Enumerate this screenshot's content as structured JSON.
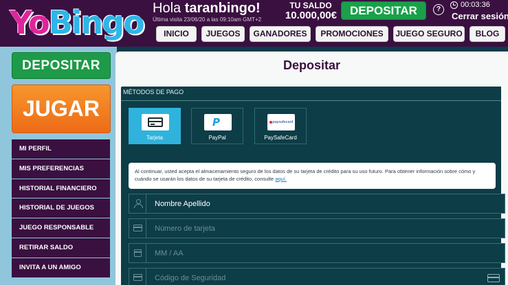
{
  "header": {
    "logo_text": "YoBingo",
    "greeting_prefix": "Hola",
    "username": "taranbingo!",
    "last_visit": "Última visita 23/06/20 a las 09:10am GMT+2",
    "saldo_label": "TU SALDO",
    "saldo_value": "10.000,00€",
    "deposit_label": "DEPOSITAR",
    "help_symbol": "?",
    "timer": "00:03:36",
    "logout_label": "Cerrar sesión"
  },
  "nav": {
    "items": [
      {
        "label": "INICIO"
      },
      {
        "label": "JUEGOS"
      },
      {
        "label": "GANADORES"
      },
      {
        "label": "PROMOCIONES"
      },
      {
        "label": "JUEGO SEGURO"
      },
      {
        "label": "BLOG"
      }
    ]
  },
  "sidebar": {
    "deposit_label": "DEPOSITAR",
    "play_label": "JUGAR",
    "menu": [
      {
        "label": "MI PERFIL"
      },
      {
        "label": "MIS PREFERENCIAS"
      },
      {
        "label": "HISTORIAL FINANCIERO"
      },
      {
        "label": "HISTORIAL DE JUEGOS"
      },
      {
        "label": "JUEGO RESPONSABLE"
      },
      {
        "label": "RETIRAR SALDO"
      },
      {
        "label": "INVITA A UN AMIGO"
      }
    ]
  },
  "main": {
    "title": "Depositar",
    "payment_section_title": "MÉTODOS DE PAGO",
    "methods": [
      {
        "label": "Tarjeta",
        "icon": "credit-card-icon",
        "selected": true
      },
      {
        "label": "PayPal",
        "icon": "paypal-icon",
        "selected": false
      },
      {
        "label": "PaySafeCard",
        "icon": "paysafecard-icon",
        "selected": false
      }
    ],
    "paypal_logo": "P",
    "paysafecard_logo": "paysafecard",
    "notice_text": "Al continuar, usted acepta el almacenamiento seguro de los datos de su tarjeta de crédito para su uso futuro. Para obtener información sobre cómo y cuándo se usarán los datos de su tarjeta de crédito, consulte",
    "notice_link": "aquí.",
    "fields": {
      "name_value": "Nombre Apellido",
      "card_placeholder": "Número de tarjeta",
      "expiry_placeholder": "MM / AA",
      "cvv_placeholder": "Código de Seguridad"
    }
  },
  "colors": {
    "header_bg": "#3a1040",
    "accent_green": "#1aa04a",
    "accent_orange": "#f08020",
    "selected_method": "#2fb3dc",
    "form_bg": "#0d3d47"
  }
}
